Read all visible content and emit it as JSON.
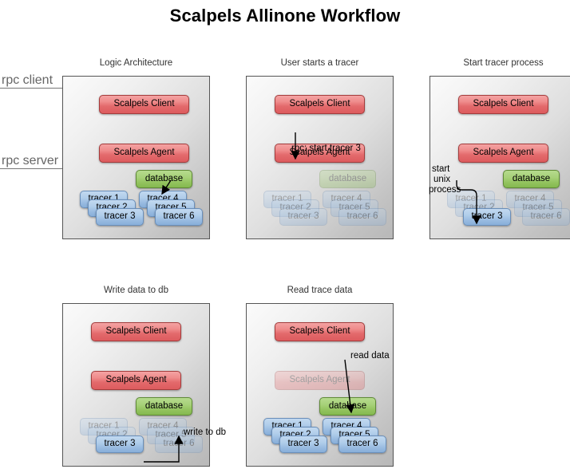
{
  "title": "Scalpels Allinone Workflow",
  "callouts": [
    {
      "label": "rpc client"
    },
    {
      "label": "rpc server"
    }
  ],
  "node_labels": {
    "client": "Scalpels Client",
    "agent": "Scalpels Agent",
    "database": "database",
    "tracer1": "tracer 1",
    "tracer2": "tracer 2",
    "tracer3": "tracer 3",
    "tracer4": "tracer 4",
    "tracer5": "tracer 5",
    "tracer6": "tracer 6"
  },
  "panels": [
    {
      "id": "logic-architecture",
      "title": "Logic Architecture",
      "edge_labels": []
    },
    {
      "id": "user-starts-a-tracer",
      "title": "User starts a tracer",
      "edge_labels": [
        {
          "text": "rpc: start tracer 3"
        }
      ]
    },
    {
      "id": "start-tracer-process",
      "title": "Start tracer process",
      "edge_labels": [
        {
          "text": "start"
        },
        {
          "text": "unix"
        },
        {
          "text": "process"
        }
      ]
    },
    {
      "id": "write-data-to-db",
      "title": "Write data to db",
      "edge_labels": [
        {
          "text": "write to db"
        }
      ]
    },
    {
      "id": "read-trace-data",
      "title": "Read trace data",
      "edge_labels": [
        {
          "text": "read data"
        }
      ]
    }
  ],
  "colors": {
    "red": "#e36a6c",
    "green": "#93c45f",
    "blue": "#96b9e0",
    "panel_border": "#555555",
    "callout_text": "#666666",
    "title_text": "#000000"
  }
}
